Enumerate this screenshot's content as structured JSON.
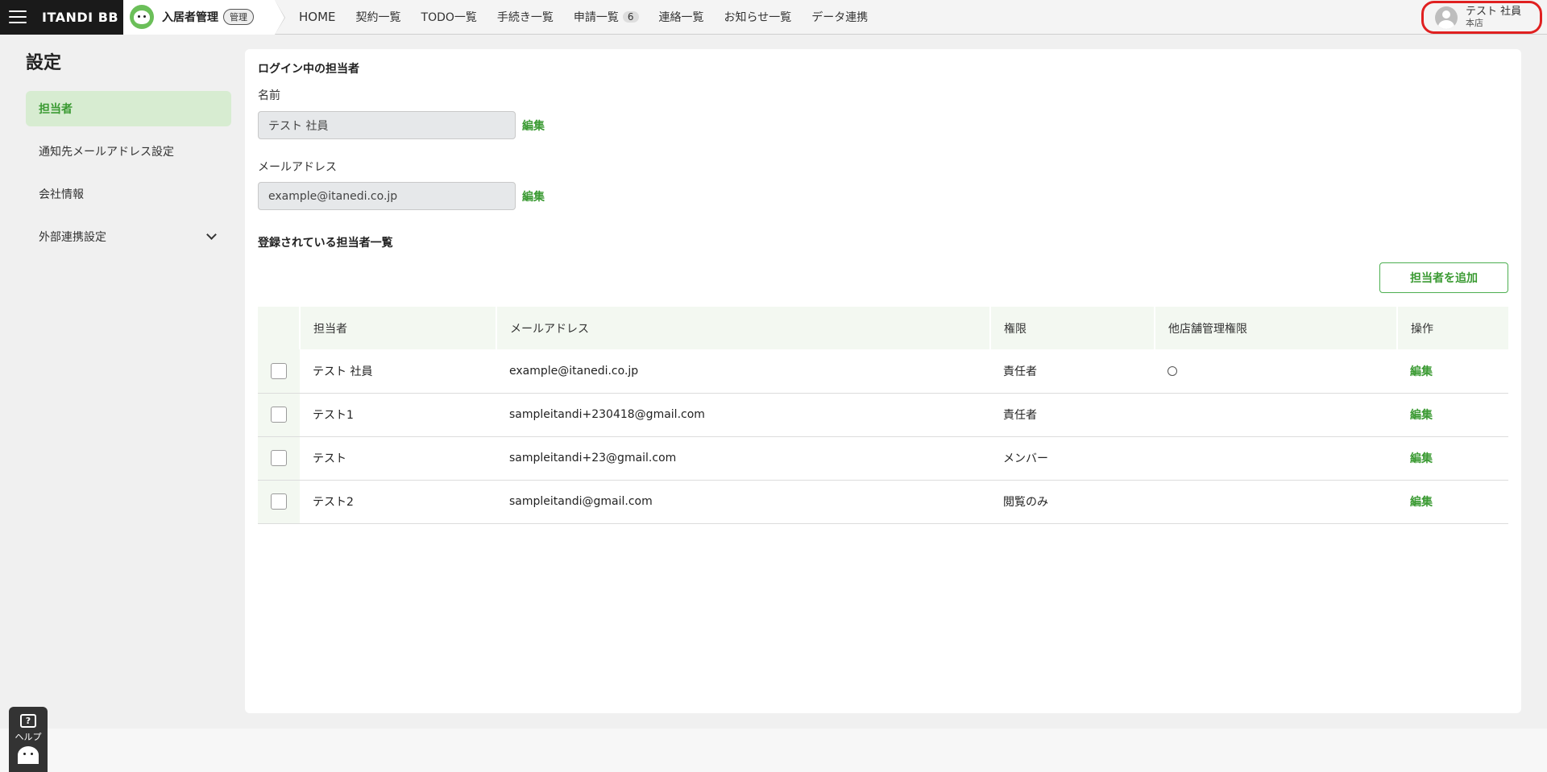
{
  "header": {
    "logo": "ITANDI BB",
    "product_name": "入居者管理",
    "admin_badge": "管理",
    "nav": {
      "home": "HOME",
      "contracts": "契約一覧",
      "todo": "TODO一覧",
      "procedures": "手続き一覧",
      "applications": "申請一覧",
      "applications_count": "6",
      "contacts": "連絡一覧",
      "notices": "お知らせ一覧",
      "data_link": "データ連携"
    },
    "user": {
      "name": "テスト 社員",
      "branch": "本店"
    }
  },
  "sidebar": {
    "title": "設定",
    "items": [
      {
        "label": "担当者"
      },
      {
        "label": "通知先メールアドレス設定"
      },
      {
        "label": "会社情報"
      },
      {
        "label": "外部連携設定"
      }
    ]
  },
  "main": {
    "login_section_title": "ログイン中の担当者",
    "name_label": "名前",
    "name_value": "テスト 社員",
    "email_label": "メールアドレス",
    "email_value": "example@itanedi.co.jp",
    "edit_label": "編集",
    "list_title": "登録されている担当者一覧",
    "add_button": "担当者を追加",
    "table": {
      "headers": {
        "staff": "担当者",
        "email": "メールアドレス",
        "role": "権限",
        "other_store": "他店舗管理権限",
        "actions": "操作"
      },
      "rows": [
        {
          "name": "テスト 社員",
          "email": "example@itanedi.co.jp",
          "role": "責任者",
          "other_store": "○",
          "action": "編集"
        },
        {
          "name": "テスト1",
          "email": "sampleitandi+230418@gmail.com",
          "role": "責任者",
          "other_store": "",
          "action": "編集"
        },
        {
          "name": "テスト",
          "email": "sampleitandi+23@gmail.com",
          "role": "メンバー",
          "other_store": "",
          "action": "編集"
        },
        {
          "name": "テスト2",
          "email": "sampleitandi@gmail.com",
          "role": "閲覧のみ",
          "other_store": "",
          "action": "編集"
        }
      ]
    }
  },
  "help": {
    "icon_glyph": "?",
    "label": "ヘルプ"
  },
  "colors": {
    "accent": "#3a9a32",
    "active_bg": "#d7ecd1",
    "highlight": "#e02020"
  }
}
